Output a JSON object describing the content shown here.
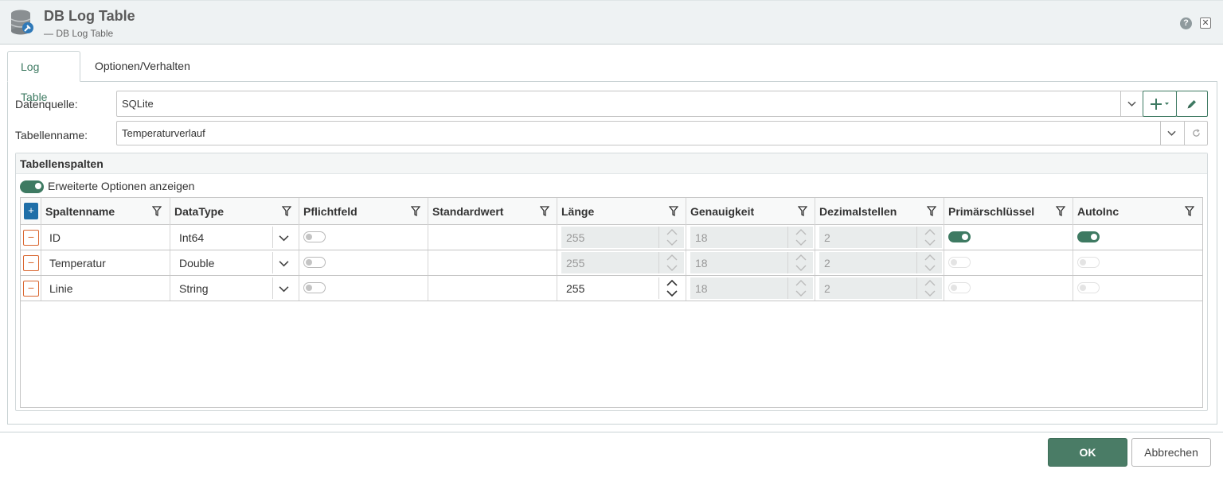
{
  "window": {
    "title": "DB Log Table",
    "subtitle": "— DB Log Table",
    "help_label": "?",
    "close_label": "✕"
  },
  "tabs": [
    {
      "label": "Log Table",
      "active": true
    },
    {
      "label": "Optionen/Verhalten",
      "active": false
    }
  ],
  "form": {
    "datasource_label": "Datenquelle:",
    "datasource_value": "SQLite",
    "tablename_label": "Tabellenname:",
    "tablename_value": "Temperaturverlauf"
  },
  "columns_section": {
    "title": "Tabellenspalten",
    "advanced_toggle_label": "Erweiterte Optionen anzeigen",
    "advanced_toggle_on": true
  },
  "grid": {
    "add_label": "+",
    "delete_label": "−",
    "headers": [
      "Spaltenname",
      "DataType",
      "Pflichtfeld",
      "Standardwert",
      "Länge",
      "Genauigkeit",
      "Dezimalstellen",
      "Primärschlüssel",
      "AutoInc"
    ],
    "rows": [
      {
        "name": "ID",
        "type": "Int64",
        "required": false,
        "default": "",
        "length": "255",
        "length_enabled": false,
        "precision": "18",
        "decimals": "2",
        "primary_key": true,
        "pk_enabled": true,
        "autoinc": true,
        "autoinc_enabled": true
      },
      {
        "name": "Temperatur",
        "type": "Double",
        "required": false,
        "default": "",
        "length": "255",
        "length_enabled": false,
        "precision": "18",
        "decimals": "2",
        "primary_key": false,
        "pk_enabled": false,
        "autoinc": false,
        "autoinc_enabled": false
      },
      {
        "name": "Linie",
        "type": "String",
        "required": false,
        "default": "",
        "length": "255",
        "length_enabled": true,
        "precision": "18",
        "decimals": "2",
        "primary_key": false,
        "pk_enabled": false,
        "autoinc": false,
        "autoinc_enabled": false
      }
    ]
  },
  "footer": {
    "ok_label": "OK",
    "cancel_label": "Abbrechen"
  },
  "colors": {
    "accent": "#3e7a62",
    "ok_button": "#4a7c66",
    "add_button": "#1f6fa8",
    "delete_border": "#d9652e"
  },
  "icons": [
    "database-settings-icon",
    "help-icon",
    "close-icon",
    "chevron-down-icon",
    "plus-dropdown-icon",
    "pencil-icon",
    "refresh-icon",
    "filter-icon",
    "add-icon",
    "remove-icon",
    "spinner-arrows-icon"
  ]
}
